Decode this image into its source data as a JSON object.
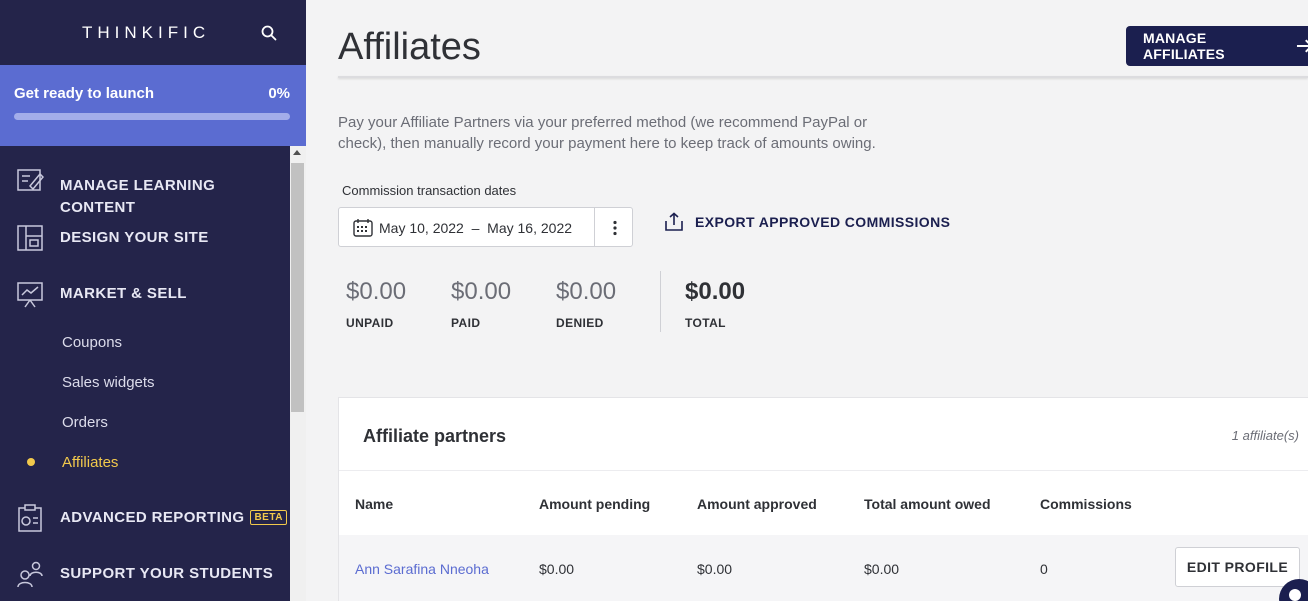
{
  "sidebar": {
    "logo": "THINKIFIC",
    "launch": {
      "title": "Get ready to launch",
      "percent": "0%",
      "progress": 0
    },
    "items": [
      {
        "label": "MANAGE LEARNING CONTENT",
        "icon": "edit-content-icon"
      },
      {
        "label": "DESIGN YOUR SITE",
        "icon": "layout-icon"
      },
      {
        "label": "MARKET & SELL",
        "icon": "chart-presentation-icon"
      },
      {
        "label": "ADVANCED REPORTING",
        "badge": "BETA",
        "icon": "report-clipboard-icon"
      },
      {
        "label": "SUPPORT YOUR STUDENTS",
        "icon": "students-icon"
      }
    ],
    "sub_items": [
      "Coupons",
      "Sales widgets",
      "Orders",
      "Affiliates"
    ]
  },
  "header": {
    "title": "Affiliates",
    "manage_label": "MANAGE AFFILIATES"
  },
  "description": "Pay your Affiliate Partners via your preferred method (we recommend PayPal or check), then manually record your payment here to keep track of amounts owing.",
  "date_filter": {
    "label": "Commission transaction dates",
    "range": "May 10, 2022  –  May 16, 2022"
  },
  "export_label": "EXPORT APPROVED COMMISSIONS",
  "stats": [
    {
      "value": "$0.00",
      "label": "UNPAID"
    },
    {
      "value": "$0.00",
      "label": "PAID"
    },
    {
      "value": "$0.00",
      "label": "DENIED"
    },
    {
      "value": "$0.00",
      "label": "TOTAL"
    }
  ],
  "partners": {
    "title": "Affiliate partners",
    "count": "1 affiliate(s)",
    "columns": [
      "Name",
      "Amount pending",
      "Amount approved",
      "Total amount owed",
      "Commissions"
    ],
    "rows": [
      {
        "name": "Ann Sarafina Nneoha",
        "pending": "$0.00",
        "approved": "$0.00",
        "owed": "$0.00",
        "commissions": "0",
        "action": "EDIT PROFILE"
      }
    ]
  },
  "colors": {
    "sidebar": "#24244a",
    "accent": "#5b6cd1",
    "active": "#f2c94c",
    "primary_button": "#1b1f4f"
  }
}
